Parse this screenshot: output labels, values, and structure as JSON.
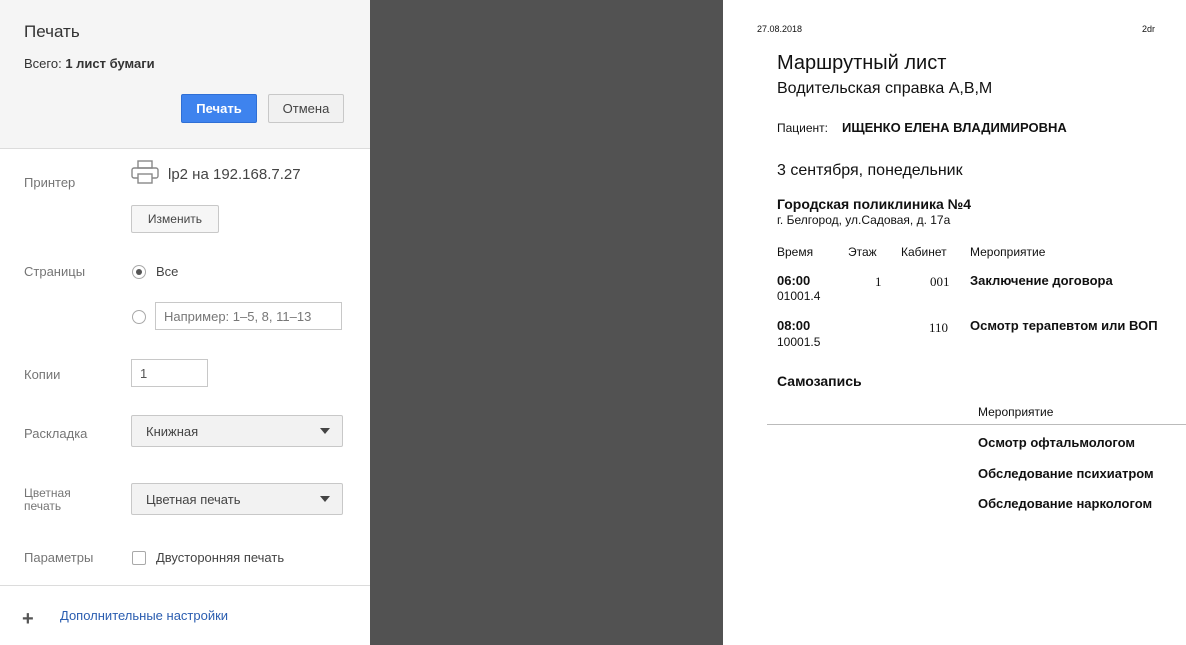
{
  "panel": {
    "title": "Печать",
    "total_prefix": "Всего:",
    "total_value": "1 лист бумаги",
    "print_button": "Печать",
    "cancel_button": "Отмена",
    "printer_label": "Принтер",
    "printer_name": "lp2 на 192.168.7.27",
    "change_button": "Изменить",
    "pages_label": "Страницы",
    "pages_all": "Все",
    "pages_placeholder": "Например: 1–5, 8, 11–13",
    "copies_label": "Копии",
    "copies_value": "1",
    "layout_label": "Раскладка",
    "layout_value": "Книжная",
    "color_label_1": "Цветная",
    "color_label_2": "печать",
    "color_value": "Цветная печать",
    "options_label": "Параметры",
    "duplex_label": "Двусторонняя печать",
    "more_settings": "Дополнительные настройки"
  },
  "preview": {
    "date": "27.08.2018",
    "page_tag": "2dr",
    "doc_title": "Маршрутный лист",
    "doc_subtitle": "Водительская справка А,В,М",
    "patient_label": "Пациент:",
    "patient_name": "ИЩЕНКО ЕЛЕНА ВЛАДИМИРОВНА",
    "day": "3 сентября, понедельник",
    "clinic_name": "Городская поликлиника №4",
    "clinic_address": "г. Белгород, ул.Садовая, д. 17а",
    "columns": [
      "Время",
      "Этаж",
      "Кабинет",
      "Мероприятие"
    ],
    "rows": [
      {
        "time": "06:00",
        "code": "01001.4",
        "floor": "1",
        "room": "001",
        "event": "Заключение договора"
      },
      {
        "time": "08:00",
        "code": "10001.5",
        "floor": "",
        "room": "110",
        "event": "Осмотр терапевтом или ВОП"
      }
    ],
    "self_title": "Самозапись",
    "self_column": "Мероприятие",
    "self_items": [
      "Осмотр офтальмологом",
      "Обследование психиатром",
      "Обследование наркологом"
    ]
  }
}
